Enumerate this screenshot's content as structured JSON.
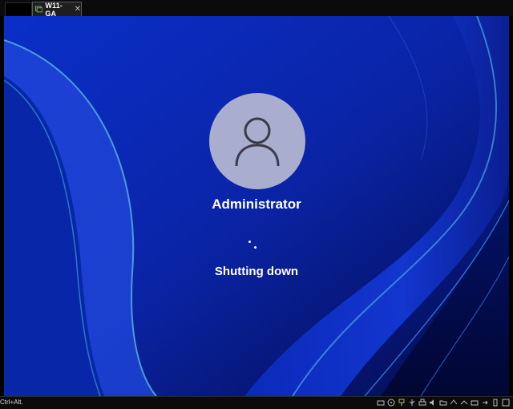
{
  "tabs": [
    {
      "label": "",
      "state": "inactive"
    },
    {
      "label": "W11-GA",
      "state": "active",
      "icon": "vm-icon",
      "close": "✕"
    }
  ],
  "lock_screen": {
    "username": "Administrator",
    "status": "Shutting down",
    "avatar_icon": "user-icon",
    "spinner": "loading-dots"
  },
  "statusbar": {
    "hotkey_hint": "Ctrl+Alt.",
    "tray_icons": [
      "hard-disk-icon",
      "cd-icon",
      "network-icon",
      "usb-icon",
      "printer-icon",
      "sound-icon",
      "shared-folder-icon",
      "display-icon",
      "capture-icon",
      "camera-icon",
      "arrow-icon",
      "monitor-icon",
      "fullscreen-icon"
    ]
  },
  "colors": {
    "wallpaper_base": "#041a9a",
    "avatar_bg": "#a9aecf",
    "text": "#ffffff",
    "chrome": "#0b0b0b"
  }
}
